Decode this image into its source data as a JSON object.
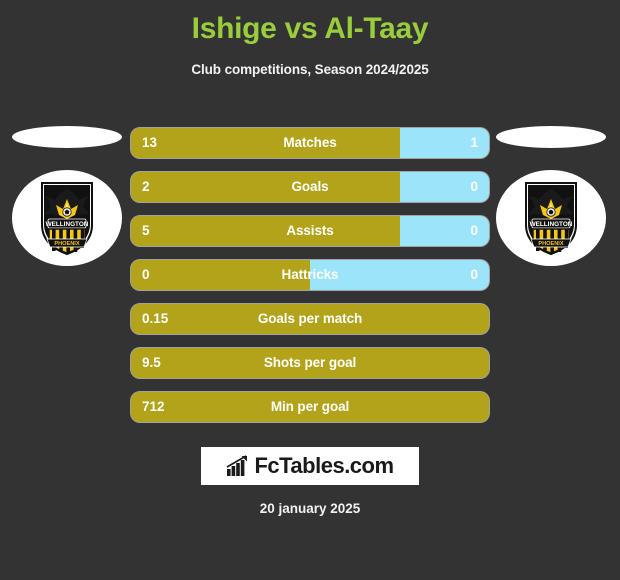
{
  "header": {
    "title": "Ishige vs Al-Taay",
    "subtitle": "Club competitions, Season 2024/2025",
    "title_color": "#9acd3c"
  },
  "colors": {
    "background": "#333333",
    "home_bar": "#b3a31a",
    "away_bar": "#9ce4fa",
    "text": "#ffffff"
  },
  "left_side": {
    "photo_placeholder": "player-photo-placeholder",
    "crest_name": "Wellington Phoenix",
    "crest_banner_top": "WELLINGTON",
    "crest_banner_bottom": "PHOENIX"
  },
  "right_side": {
    "photo_placeholder": "player-photo-placeholder",
    "crest_name": "Wellington Phoenix",
    "crest_banner_top": "WELLINGTON",
    "crest_banner_bottom": "PHOENIX"
  },
  "stats": [
    {
      "label": "Matches",
      "home": "13",
      "away": "1",
      "home_pct": 75,
      "away_pct": 25,
      "split": true
    },
    {
      "label": "Goals",
      "home": "2",
      "away": "0",
      "home_pct": 75,
      "away_pct": 25,
      "split": true
    },
    {
      "label": "Assists",
      "home": "5",
      "away": "0",
      "home_pct": 75,
      "away_pct": 25,
      "split": true
    },
    {
      "label": "Hattricks",
      "home": "0",
      "away": "0",
      "home_pct": 50,
      "away_pct": 50,
      "split": true
    },
    {
      "label": "Goals per match",
      "home": "0.15",
      "away": "",
      "home_pct": 100,
      "away_pct": 0,
      "split": false
    },
    {
      "label": "Shots per goal",
      "home": "9.5",
      "away": "",
      "home_pct": 100,
      "away_pct": 0,
      "split": false
    },
    {
      "label": "Min per goal",
      "home": "712",
      "away": "",
      "home_pct": 100,
      "away_pct": 0,
      "split": false
    }
  ],
  "branding": {
    "logo_text": "FcTables.com",
    "logo_icon": "bar-chart-growth-icon"
  },
  "footer": {
    "date": "20 january 2025"
  }
}
